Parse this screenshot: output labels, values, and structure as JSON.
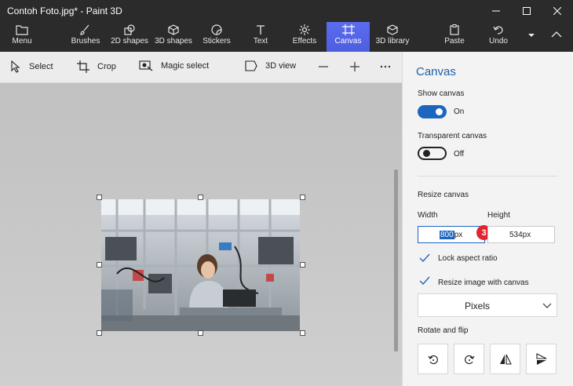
{
  "window": {
    "title": "Contoh Foto.jpg* - Paint 3D",
    "minimize_icon": "minimize-icon",
    "maximize_icon": "maximize-icon",
    "close_icon": "close-icon"
  },
  "ribbon": {
    "items": [
      {
        "label": "Menu",
        "icon": "folder-icon"
      },
      {
        "label": "Brushes",
        "icon": "brush-icon"
      },
      {
        "label": "2D shapes",
        "icon": "shapes-2d-icon"
      },
      {
        "label": "3D shapes",
        "icon": "cube-icon"
      },
      {
        "label": "Stickers",
        "icon": "sticker-icon"
      },
      {
        "label": "Text",
        "icon": "text-icon"
      },
      {
        "label": "Effects",
        "icon": "effects-icon"
      },
      {
        "label": "Canvas",
        "icon": "canvas-icon",
        "active": true
      },
      {
        "label": "3D library",
        "icon": "library-icon"
      },
      {
        "label": "Paste",
        "icon": "paste-icon"
      },
      {
        "label": "Undo",
        "icon": "undo-icon"
      }
    ],
    "accent_color": "#4d5ee0"
  },
  "toolbar": {
    "select": "Select",
    "crop": "Crop",
    "magic_select": "Magic select",
    "view_3d": "3D view"
  },
  "panel": {
    "title": "Canvas",
    "show_canvas_label": "Show canvas",
    "show_canvas_state": "On",
    "transparent_label": "Transparent canvas",
    "transparent_state": "Off",
    "resize_label": "Resize canvas",
    "width_label": "Width",
    "height_label": "Height",
    "width_value": "800",
    "width_unit": "px",
    "height_value": "534px",
    "badge": "3",
    "lock_aspect": "Lock aspect ratio",
    "resize_image": "Resize image with canvas",
    "units": "Pixels",
    "rotate_label": "Rotate and flip",
    "rotate_buttons": [
      "rotate-left-icon",
      "rotate-right-icon",
      "flip-horizontal-icon",
      "flip-vertical-icon"
    ],
    "accent_color": "#1d66c0",
    "badge_color": "#e0252e"
  }
}
